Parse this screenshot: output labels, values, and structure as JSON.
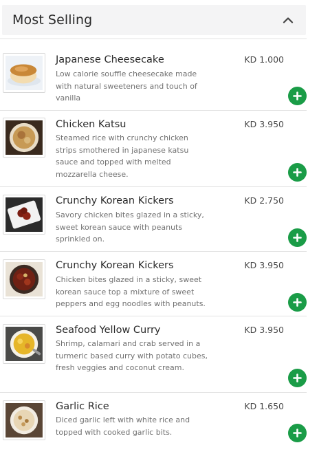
{
  "section": {
    "title": "Most Selling",
    "collapse_icon": "chevron-up-icon"
  },
  "items": [
    {
      "name": "Japanese Cheesecake",
      "description": "Low calorie souffle cheesecake made with natural sweeteners and touch of vanilla",
      "price": "KD 1.000"
    },
    {
      "name": "Chicken Katsu",
      "description": "Steamed rice with crunchy chicken strips smothered in japanese katsu sauce and topped with melted mozzarella cheese.",
      "price": "KD 3.950"
    },
    {
      "name": "Crunchy Korean Kickers",
      "description": "Savory chicken bites glazed in a sticky, sweet korean sauce with peanuts sprinkled on.",
      "price": "KD 2.750"
    },
    {
      "name": "Crunchy Korean Kickers",
      "description": "Chicken bites glazed in a sticky, sweet korean sauce top a mixture of sweet peppers and egg noodles with peanuts.",
      "price": "KD 3.950"
    },
    {
      "name": "Seafood Yellow Curry",
      "description": "Shrimp, calamari and crab served in a turmeric based curry with potato cubes, fresh veggies and coconut cream.",
      "price": "KD 3.950"
    },
    {
      "name": "Garlic Rice",
      "description": "Diced garlic left with white rice and topped with cooked garlic bits.",
      "price": "KD 1.650"
    }
  ],
  "colors": {
    "add_button": "#1a9c47",
    "header_bg": "#f4f4f5"
  }
}
